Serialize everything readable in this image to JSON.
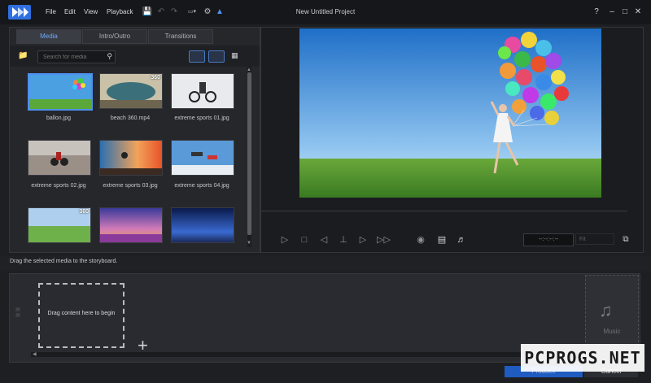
{
  "menu": [
    "File",
    "Edit",
    "View",
    "Playback"
  ],
  "window": {
    "title": "New Untitled Project",
    "help": "?",
    "minimize": "–",
    "maximize": "□",
    "close": "✕"
  },
  "toolbar_icons": [
    "save-icon",
    "undo-icon",
    "redo-icon",
    "aspect-ratio-icon",
    "settings-icon",
    "upgrade-icon"
  ],
  "library": {
    "tabs": [
      "Media",
      "Intro/Outro",
      "Transitions"
    ],
    "active_tab": "Media",
    "search_placeholder": "Search for media",
    "items": [
      {
        "label": "ballon.jpg",
        "badge": ""
      },
      {
        "label": "beach 360.mp4",
        "badge": "360"
      },
      {
        "label": "extreme sports 01.jpg",
        "badge": ""
      },
      {
        "label": "extreme sports 02.jpg",
        "badge": ""
      },
      {
        "label": "extreme sports 03.jpg",
        "badge": ""
      },
      {
        "label": "extreme sports 04.jpg",
        "badge": ""
      },
      {
        "label": "",
        "badge": "360"
      },
      {
        "label": "",
        "badge": ""
      },
      {
        "label": "",
        "badge": ""
      }
    ]
  },
  "preview": {
    "controls": [
      "play",
      "stop",
      "previous-frame",
      "split",
      "next-frame",
      "fast-forward",
      "snapshot",
      "subtitles",
      "volume"
    ],
    "timecode": "--:--:--:--",
    "quality": "Fit"
  },
  "storyboard": {
    "hint": "Drag the selected media to the storyboard.",
    "drop_text": "Drag content here to begin",
    "music_label": "Music"
  },
  "buttons": {
    "produce": "Produce",
    "cancel": "Cancel"
  },
  "watermark": "PCPROGS.NET",
  "colors": {
    "accent": "#4f8ff0",
    "background": "#1e1f22",
    "panel": "#25272b"
  }
}
